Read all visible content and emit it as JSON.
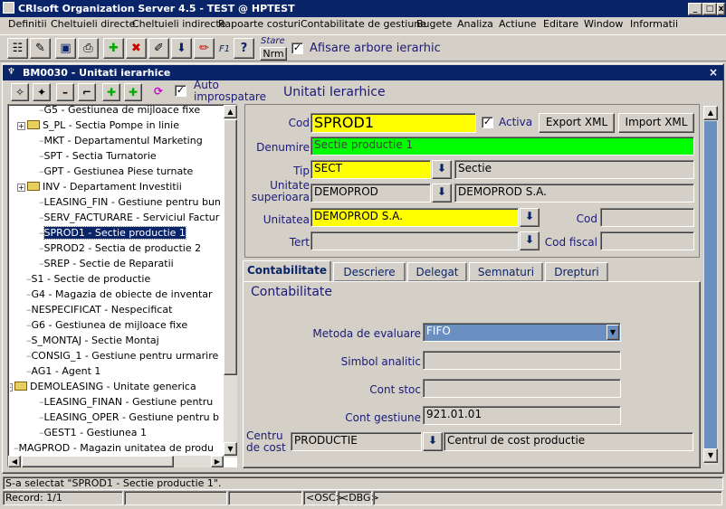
{
  "app": {
    "title": "CRIsoft Organization Server 4.5 - TEST @ HPTEST"
  },
  "menu": [
    "Definitii",
    "Cheltuieli directe",
    "Cheltuieli indirecte",
    "Rapoarte costuri",
    "Contabilitate de gestiune",
    "Bugete",
    "Analiza",
    "Actiune",
    "Editare",
    "Window",
    "Informatii"
  ],
  "toolbar": {
    "stare_label": "Stare",
    "nrm_label": "Nrm",
    "f1_label": "F1",
    "afisare_label": "Afisare arbore ierarhic",
    "afisare_checked": true
  },
  "child": {
    "title": "BM0030 - Unitati ierarhice",
    "auto_label": "Auto\nimprospatare",
    "auto_checked": true,
    "heading": "Unitati Ierarhice"
  },
  "tree": [
    {
      "text": "G5 - Gestiunea de mijloace fixe",
      "level": 2,
      "folder": false,
      "expand": false
    },
    {
      "text": "S_PL - Sectia Pompe in linie",
      "level": 1,
      "folder": true,
      "expand": true
    },
    {
      "text": "MKT - Departamentul Marketing",
      "level": 2,
      "folder": false,
      "expand": false
    },
    {
      "text": "SPT - Sectia Turnatorie",
      "level": 2,
      "folder": false,
      "expand": false
    },
    {
      "text": "GPT - Gestiunea Piese turnate",
      "level": 2,
      "folder": false,
      "expand": false
    },
    {
      "text": "INV - Departament Investitii",
      "level": 1,
      "folder": true,
      "expand": true
    },
    {
      "text": "LEASING_FIN - Gestiune pentru  bun",
      "level": 2,
      "folder": false,
      "expand": false
    },
    {
      "text": "SERV_FACTURARE - Serviciul Factur",
      "level": 2,
      "folder": false,
      "expand": false
    },
    {
      "text": "SPROD1 - Sectie productie 1",
      "level": 2,
      "folder": false,
      "expand": false,
      "selected": true
    },
    {
      "text": "SPROD2 - Sectia de productie 2",
      "level": 2,
      "folder": false,
      "expand": false
    },
    {
      "text": "SREP - Sectie de Reparatii",
      "level": 2,
      "folder": false,
      "expand": false
    },
    {
      "text": "S1 - Sectie de productie",
      "level": 1,
      "folder": false,
      "expand": false
    },
    {
      "text": "G4 - Magazia de obiecte de inventar",
      "level": 1,
      "folder": false,
      "expand": false
    },
    {
      "text": "NESPECIFICAT - Nespecificat",
      "level": 1,
      "folder": false,
      "expand": false
    },
    {
      "text": "G6 - Gestiunea de mijloace fixe",
      "level": 1,
      "folder": false,
      "expand": false
    },
    {
      "text": "S_MONTAJ - Sectie Montaj",
      "level": 1,
      "folder": false,
      "expand": false
    },
    {
      "text": "CONSIG_1 - Gestiune pentru urmarire",
      "level": 1,
      "folder": false,
      "expand": false
    },
    {
      "text": "AG1 - Agent 1",
      "level": 1,
      "folder": false,
      "expand": false
    },
    {
      "text": "DEMOLEASING - Unitate generica",
      "level": 0,
      "folder": true,
      "expand": true
    },
    {
      "text": "LEASING_FINAN - Gestiune pentru",
      "level": 2,
      "folder": false,
      "expand": false
    },
    {
      "text": "LEASING_OPER - Gestiune pentru  b",
      "level": 2,
      "folder": false,
      "expand": false
    },
    {
      "text": "GEST1 - Gestiunea 1",
      "level": 2,
      "folder": false,
      "expand": false
    },
    {
      "text": "MAGPROD - Magazin unitatea de produ",
      "level": 0,
      "folder": false,
      "expand": false
    }
  ],
  "form": {
    "cod_label": "Cod",
    "cod_value": "SPROD1",
    "activa_label": "Activa",
    "activa_checked": true,
    "export_label": "Export XML",
    "import_label": "Import XML",
    "denumire_label": "Denumire",
    "denumire_value": "Sectie productie 1",
    "tip_label": "Tip",
    "tip_code": "SECT",
    "tip_desc": "Sectie",
    "unitate_sup_label": "Unitate\nsuperioara",
    "unitate_sup_code": "DEMOPROD",
    "unitate_sup_desc": "DEMOPROD S.A.",
    "unitatea_label": "Unitatea",
    "unitatea_value": "DEMOPROD S.A.",
    "cod2_label": "Cod",
    "cod2_value": "",
    "tert_label": "Tert",
    "tert_value": "",
    "cod_fiscal_label": "Cod fiscal",
    "cod_fiscal_value": ""
  },
  "tabs": [
    {
      "label": "Contabilitate",
      "active": true
    },
    {
      "label": "Descriere"
    },
    {
      "label": "Delegat"
    },
    {
      "label": "Semnaturi"
    },
    {
      "label": "Drepturi"
    }
  ],
  "contab": {
    "heading": "Contabilitate",
    "metoda_label": "Metoda de evaluare",
    "metoda_value": "FIFO",
    "simbol_label": "Simbol analitic",
    "simbol_value": "",
    "cont_stoc_label": "Cont stoc",
    "cont_stoc_value": "",
    "cont_gestiune_label": "Cont gestiune",
    "cont_gestiune_value": "921.01.01",
    "centru_label": "Centru\nde cost",
    "centru_code": "PRODUCTIE",
    "centru_desc": "Centrul de cost productie"
  },
  "status": {
    "message": "S-a selectat \"SPROD1 - Sectie productie 1\".",
    "record": "Record: 1/1",
    "osc": "<OSC>",
    "dbg": "<DBG>"
  },
  "colors": {
    "title_bg": "#0a246a",
    "yellow": "#ffff00",
    "green": "#00ff00",
    "select_blue": "#6b8fc0"
  }
}
